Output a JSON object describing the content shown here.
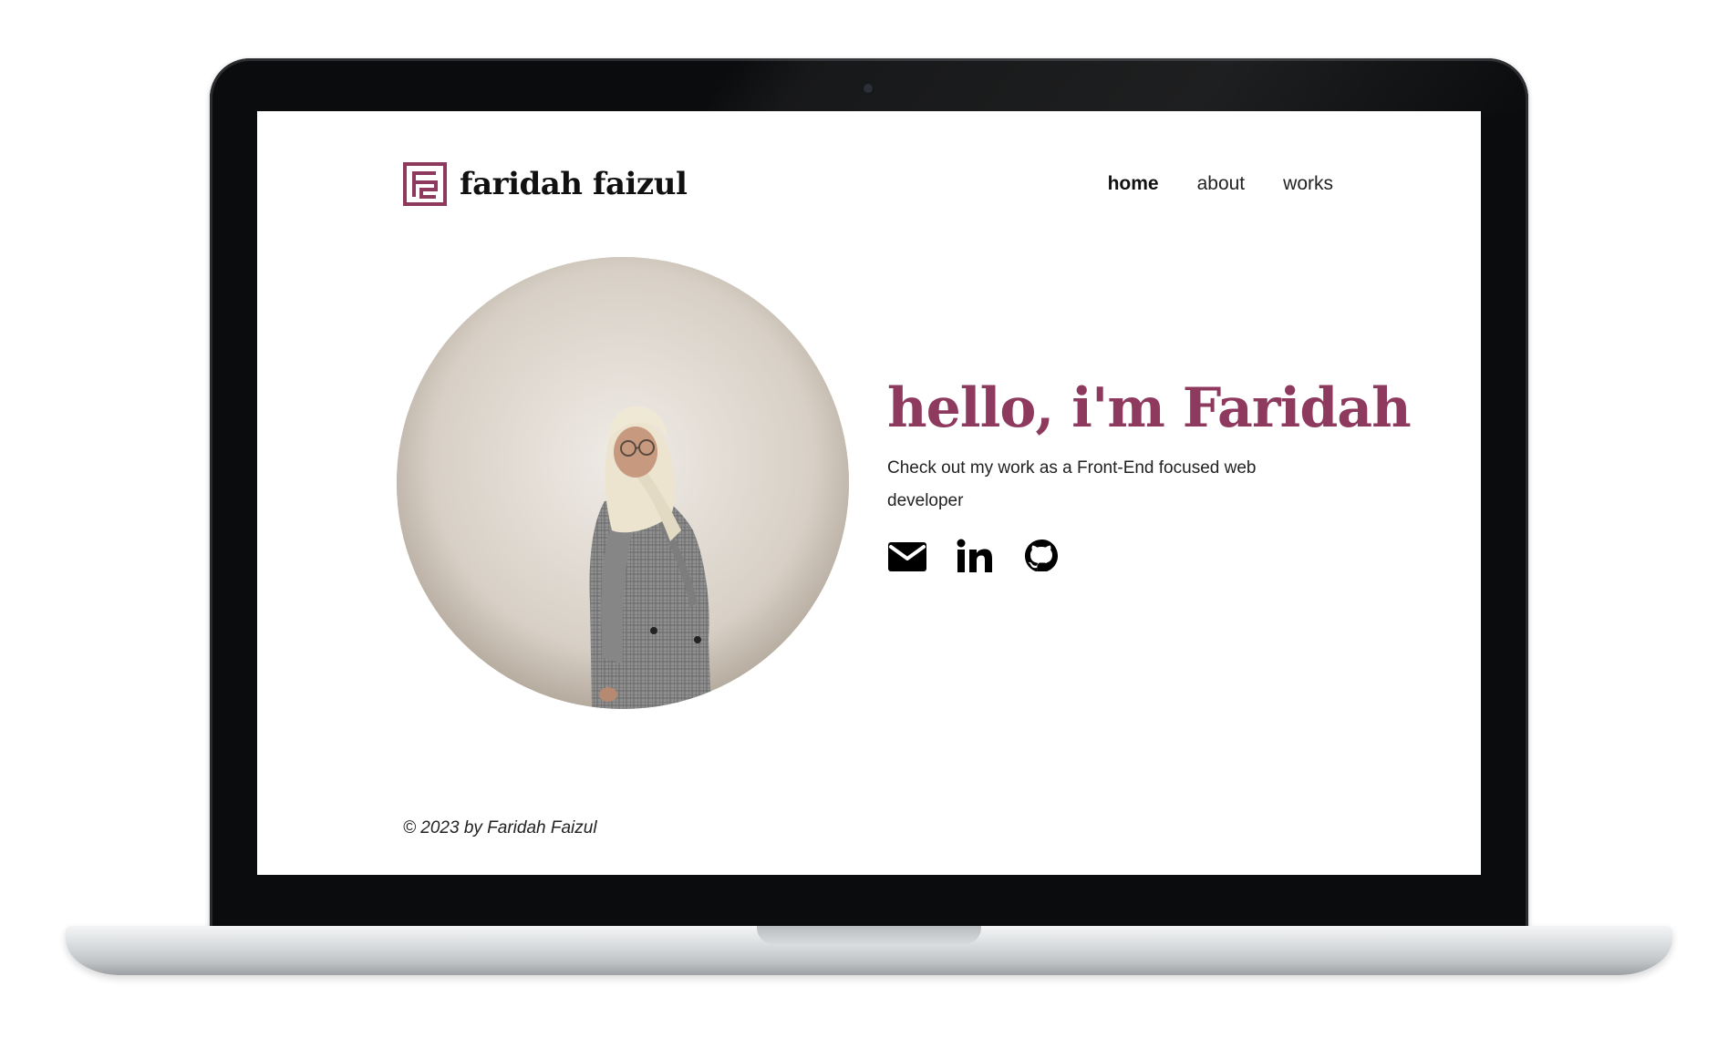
{
  "site": {
    "brand_name": "faridah faizul",
    "brand_color": "#8e3a5e",
    "logo_icon": "f-monogram-icon"
  },
  "nav": {
    "items": [
      {
        "label": "home",
        "active": true
      },
      {
        "label": "about",
        "active": false
      },
      {
        "label": "works",
        "active": false
      }
    ]
  },
  "hero": {
    "photo": "portrait-photo",
    "title": "hello, i'm Faridah",
    "subtitle": "Check out my work as a Front-End focused web developer",
    "socials": [
      {
        "icon": "envelope-icon"
      },
      {
        "icon": "linkedin-icon"
      },
      {
        "icon": "github-icon"
      }
    ]
  },
  "footer": {
    "copyright": "© 2023 by Faridah Faizul"
  }
}
